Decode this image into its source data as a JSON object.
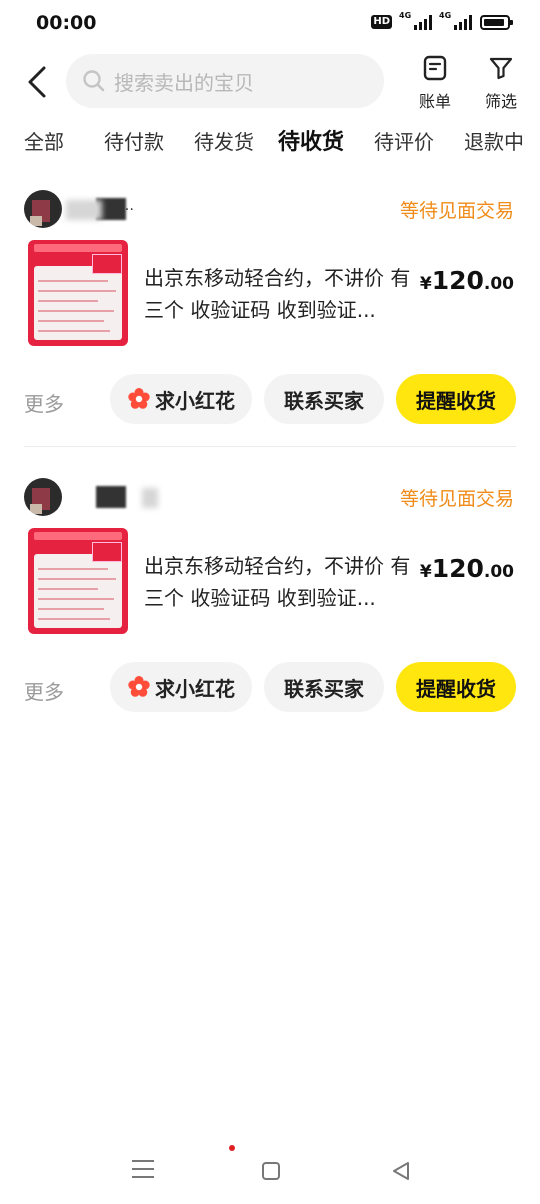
{
  "status_bar": {
    "time": "00:00",
    "hd": "HD",
    "network_1": "4G",
    "network_2": "4G"
  },
  "header": {
    "back_icon": "chevron-left-icon",
    "search_placeholder": "搜索卖出的宝贝",
    "bill_label": "账单",
    "filter_label": "筛选"
  },
  "tabs": [
    {
      "label": "全部",
      "active": false
    },
    {
      "label": "待付款",
      "active": false
    },
    {
      "label": "待发货",
      "active": false
    },
    {
      "label": "待收货",
      "active": true
    },
    {
      "label": "待评价",
      "active": false
    },
    {
      "label": "退款中",
      "active": false
    }
  ],
  "orders": [
    {
      "buyer_name": "…",
      "status": "等待见面交易",
      "title": "出京东移动轻合约，不讲价 有三个 收验证码 收到验证...",
      "price_currency": "¥",
      "price_int": "120",
      "price_dec": ".00",
      "more_label": "更多",
      "flower_button": "求小红花",
      "contact_button": "联系买家",
      "remind_button": "提醒收货"
    },
    {
      "buyer_name": "",
      "status": "等待见面交易",
      "title": "出京东移动轻合约，不讲价 有三个 收验证码 收到验证...",
      "price_currency": "¥",
      "price_int": "120",
      "price_dec": ".00",
      "more_label": "更多",
      "flower_button": "求小红花",
      "contact_button": "联系买家",
      "remind_button": "提醒收货"
    }
  ],
  "colors": {
    "accent_yellow": "#ffe60f",
    "status_orange": "#f08c1a",
    "flower_red": "#ff4d3a"
  }
}
